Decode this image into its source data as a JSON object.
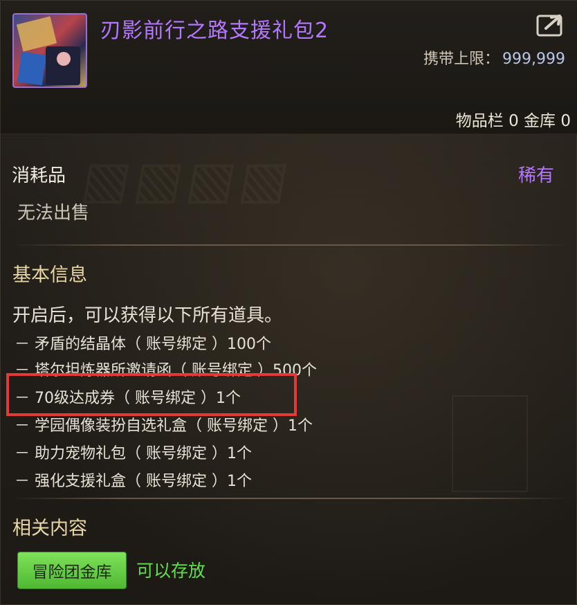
{
  "header": {
    "title": "刃影前行之路支援礼包2",
    "limit_label": "携带上限：",
    "limit_value": "999,999",
    "storage": "物品栏 0 金库 0"
  },
  "item": {
    "category": "消耗品",
    "rarity": "稀有",
    "sell_status": "无法出售"
  },
  "basic_info": {
    "title": "基本信息",
    "description": "开启后，可以获得以下所有道具。",
    "items": [
      "－ 矛盾的结晶体（ 账号绑定 ）100个",
      "－ 塔尔坦炼器所邀请函（ 账号绑定 ）500个",
      "－ 70级达成券（ 账号绑定 ）1个",
      "－ 学园偶像装扮自选礼盒（ 账号绑定 ）1个",
      "－ 助力宠物礼包（ 账号绑定 ）1个",
      "－ 强化支援礼盒（ 账号绑定 ）1个"
    ]
  },
  "related": {
    "title": "相关内容",
    "button_label": "冒险团金库",
    "status": "可以存放"
  },
  "colors": {
    "rarity": "#b478ff",
    "highlight": "#e53935",
    "button": "#5ec83a"
  },
  "icons": {
    "export": "share-export-icon",
    "item": "gift-package-icon"
  }
}
